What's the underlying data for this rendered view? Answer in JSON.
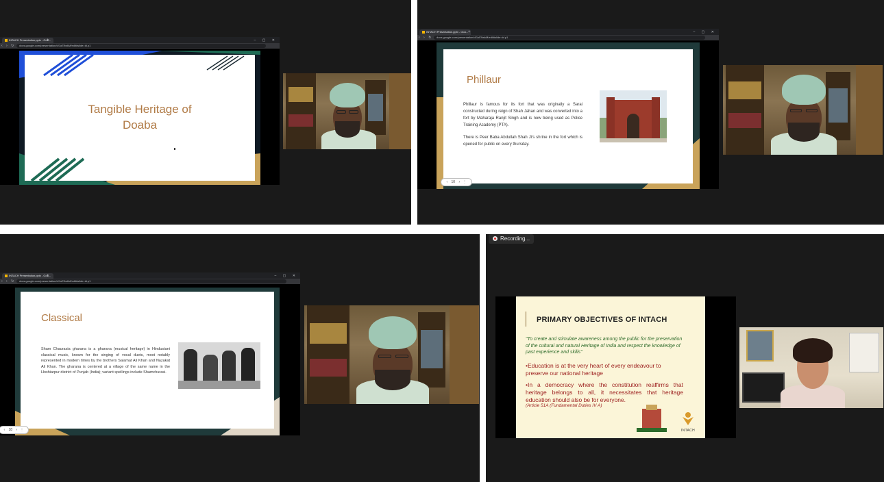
{
  "browser": {
    "tab_title": "INTACH Presentation.pptx - Goo...",
    "url": "docs.google.com/presentation/d/1oE9wkM/edit#slide=id.p1"
  },
  "panels": {
    "top_left": {
      "slide_title": "Tangible Heritage of Doaba"
    },
    "top_right": {
      "slide_heading": "Phillaur",
      "para1": "Phillaur is famous for its fort that was originally a Sarai constructed during reign of Shah Jahan and was converted into a fort by Maharaja Ranjit Singh and is now being used as Police Training Academy (PTA).",
      "para2": "There is Peer Baba Abdullah Shah Ji's shrine in the fort which is opened for public on every thursday.",
      "slide_number": "10"
    },
    "bottom_left": {
      "slide_heading": "Classical",
      "para": "Sham Chaurasia gharana is a gharana (musical heritage) in Hindustani classical music, known for the singing of vocal duets, most notably represented in modern times by the brothers Salamat Ali Khan and Nazakat Ali Khan. The gharana is centered at a village of the same name in the Hoshiarpur district of Punjab (India); variant spellings include Shamchurasi.",
      "slide_number": "18"
    },
    "bottom_right": {
      "recording_label": "Recording...",
      "slide_heading": "PRIMARY OBJECTIVES OF INTACH",
      "quote": "\"To create and stimulate awareness among the public for the preservation of the cultural and natural Heritage of India and respect the knowledge of past experience and skills\"",
      "bullet1": "•Education is at the very heart of every endeavour to preserve our national heritage",
      "bullet2": "•In a democracy where the constitution reaffirms that heritage belongs to all, it necessitates that heritage education should also be for everyone.",
      "article": "(Article 51A (Fundamental Duties IV A)",
      "logo_text": "INTACH"
    }
  },
  "colors": {
    "accent_brown": "#b07a45",
    "dark_teal": "#1f4e4c",
    "green_bar": "#1e6b55",
    "gold": "#c9a35a",
    "blue": "#1f4fd8",
    "intach_red": "#9b1c1c",
    "intach_green": "#2d6b2a",
    "slide_cream": "#fbf5d8"
  }
}
